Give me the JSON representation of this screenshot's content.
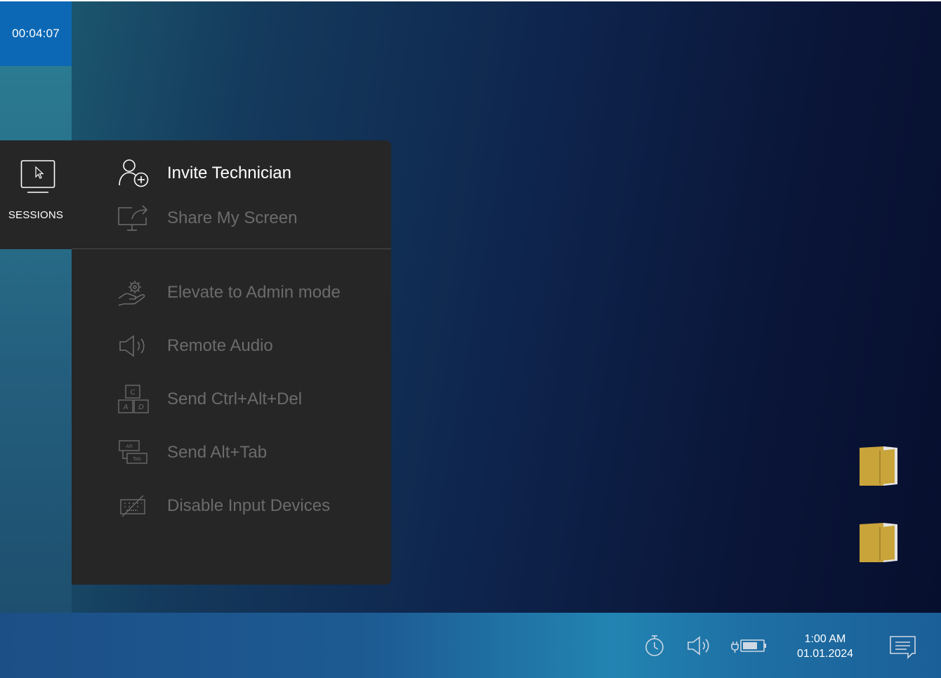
{
  "session_timer": "00:04:07",
  "sidebar": {
    "sessions_label": "SESSIONS",
    "sessions_icon": "monitor-cursor-icon"
  },
  "menu": {
    "items": [
      {
        "label": "Invite Technician",
        "icon": "user-add-icon",
        "enabled": true
      },
      {
        "label": "Share My Screen",
        "icon": "screen-share-icon",
        "enabled": false
      },
      {
        "label": "Elevate to Admin mode",
        "icon": "hand-gear-icon",
        "enabled": false
      },
      {
        "label": "Remote Audio",
        "icon": "speaker-icon",
        "enabled": false
      },
      {
        "label": "Send Ctrl+Alt+Del",
        "icon": "keys-cad-icon",
        "enabled": false
      },
      {
        "label": "Send Alt+Tab",
        "icon": "keys-alt-tab-icon",
        "enabled": false
      },
      {
        "label": "Disable Input Devices",
        "icon": "keyboard-disabled-icon",
        "enabled": false
      }
    ]
  },
  "taskbar": {
    "time": "1:00 AM",
    "date": "01.01.2024",
    "icons": [
      "stopwatch-icon",
      "volume-icon",
      "battery-charging-icon",
      "notifications-icon"
    ]
  },
  "desktop_icons": [
    "folder-icon",
    "folder-icon"
  ],
  "colors": {
    "timer_bg": "#0c68b4",
    "panel_bg": "#262626",
    "disabled_text": "#6b6b6b",
    "folder": "#c9a43a"
  }
}
